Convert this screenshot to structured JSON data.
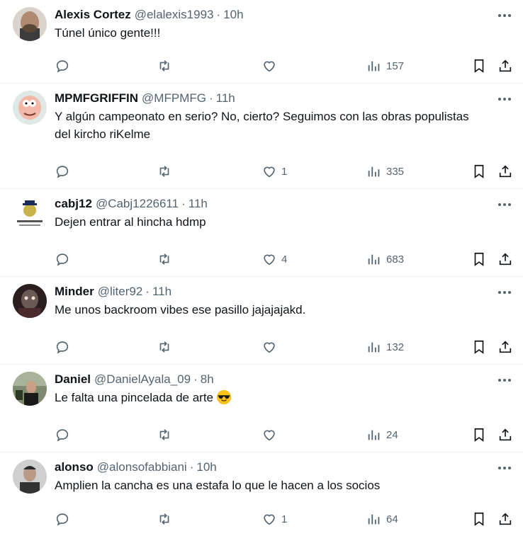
{
  "tweets": [
    {
      "name": "Alexis Cortez",
      "handle": "@elalexis1993",
      "time": "10h",
      "text": "Túnel único gente!!!",
      "likes": "",
      "views": "157",
      "avatar": "#8a7b6d"
    },
    {
      "name": "MPMFGRIFFIN",
      "handle": "@MFPMFG",
      "time": "11h",
      "text": "Y algún campeonato en serio? No, cierto? Seguimos con las obras populistas del kircho riKelme",
      "likes": "1",
      "views": "335",
      "avatar": "#f2b8a8"
    },
    {
      "name": "cabj12",
      "handle": "@Cabj1226611",
      "time": "11h",
      "text": "Dejen entrar al hincha hdmp",
      "likes": "4",
      "views": "683",
      "avatar": "#ffffff"
    },
    {
      "name": "Minder",
      "handle": "@liter92",
      "time": "11h",
      "text": "Me unos backroom vibes ese pasillo jajajajakd.",
      "likes": "",
      "views": "132",
      "avatar": "#3a2a2a"
    },
    {
      "name": "Daniel",
      "handle": "@DanielAyala_09",
      "time": "8h",
      "text": "Le falta una pincelada de arte",
      "likes": "",
      "views": "24",
      "avatar": "#5c6b4e"
    },
    {
      "name": "alonso",
      "handle": "@alonsofabbiani",
      "time": "10h",
      "text": "Amplien la cancha es una estafa lo que le hacen a los socios",
      "likes": "1",
      "views": "64",
      "avatar": "#4a4a4a"
    }
  ],
  "colors": {
    "secondary": "#536471",
    "primary_text": "#0f1419",
    "divider": "#eff3f4"
  }
}
